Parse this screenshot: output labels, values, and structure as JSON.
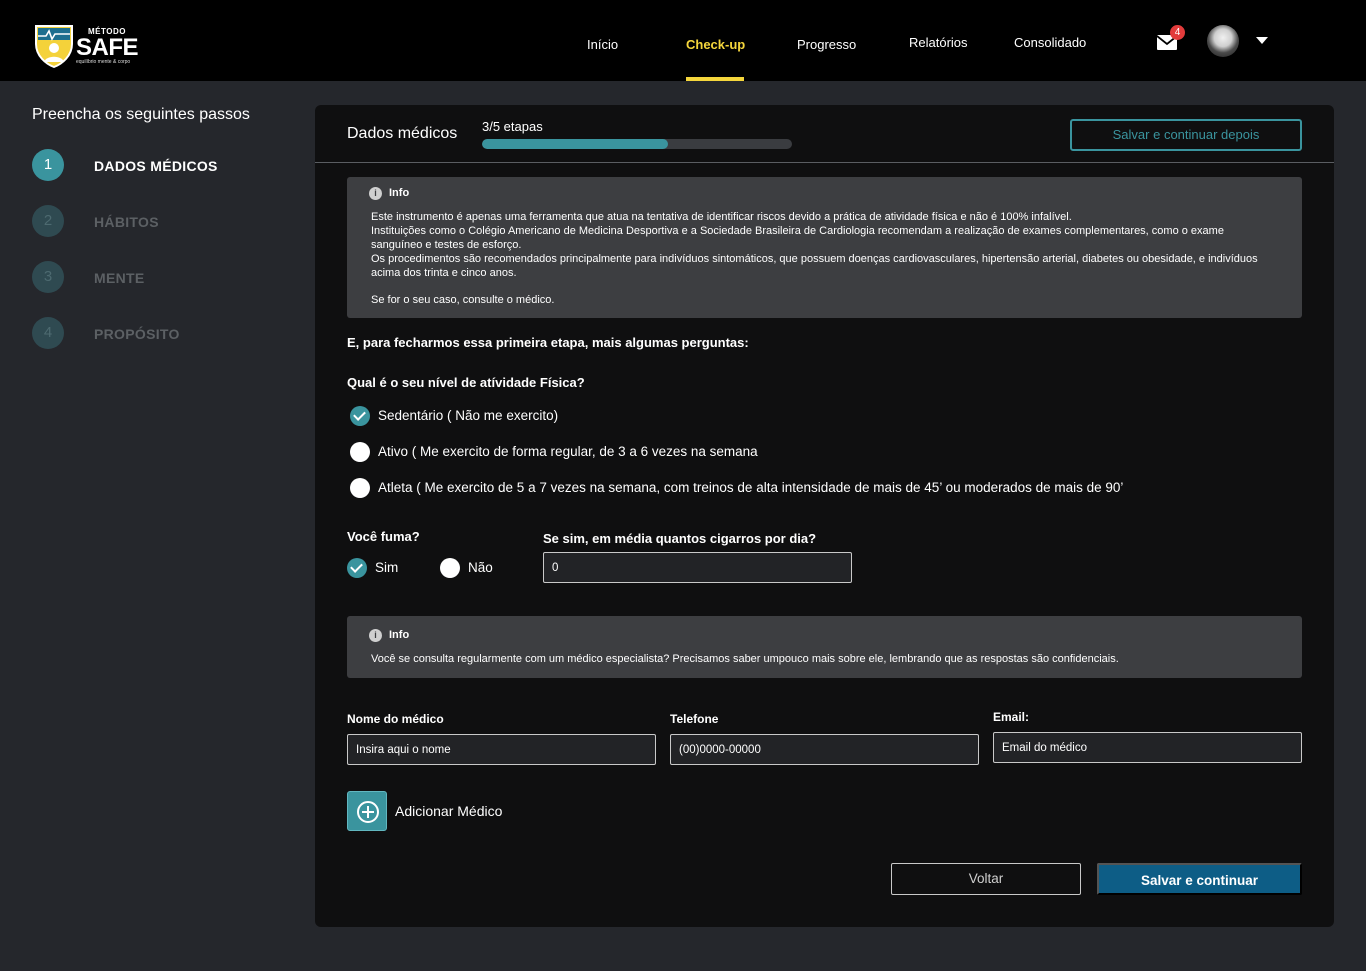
{
  "header": {
    "logo": {
      "top": "MÉTODO",
      "main": "SAFE",
      "sub": "equilíbrio mente & corpo"
    },
    "nav": [
      {
        "label": "Início"
      },
      {
        "label": "Check-up"
      },
      {
        "label": "Progresso"
      },
      {
        "label": "Relatórios"
      },
      {
        "label": "Consolidado"
      }
    ],
    "active_nav": "Check-up",
    "mail_badge": "4",
    "icons": [
      "mail-icon",
      "avatar",
      "chevron-down-icon"
    ]
  },
  "sidebar": {
    "title": "Preencha os seguintes passos",
    "steps": [
      {
        "number": "1",
        "label": "DADOS MÉDICOS",
        "active": true
      },
      {
        "number": "2",
        "label": "HÁBITOS",
        "active": false
      },
      {
        "number": "3",
        "label": "MENTE",
        "active": false
      },
      {
        "number": "4",
        "label": "PROPÓSITO",
        "active": false
      }
    ]
  },
  "card": {
    "title": "Dados médicos",
    "steps_text": "3/5 etapas",
    "progress_fraction": 0.6,
    "save_later_label": "Salvar e continuar depois",
    "info1": {
      "heading": "Info",
      "line1": "Este instrumento é apenas uma ferramenta que atua na tentativa de identificar riscos devido a prática de atividade física e não é 100% infalível.",
      "line2": "Instituições como o Colégio Americano de Medicina Desportiva e a Sociedade Brasileira de Cardiologia recomendam a realização de exames complementares, como o exame sanguíneo e testes de esforço.",
      "line3": "Os procedimentos são recomendados principalmente para indivíduos sintomáticos, que possuem doenças cardiovasculares, hipertensão arterial, diabetes ou obesidade, e indivíduos acima dos trinta e cinco anos.",
      "line4": "Se for o seu caso, consulte o médico."
    },
    "intro": "E, para fecharmos essa primeira etapa, mais algumas perguntas:",
    "activity_question": "Qual é o seu nível de atívidade Física?",
    "activity_options": [
      {
        "label": "Sedentário ( Não me exercito)",
        "checked": true
      },
      {
        "label": "Ativo ( Me exercito de forma regular, de 3 a 6 vezes na semana",
        "checked": false
      },
      {
        "label": "Atleta ( Me exercito de 5 a 7 vezes na semana, com treinos de alta intensidade de mais de 45’ ou moderados de mais de 90’",
        "checked": false
      }
    ],
    "smoke_question": "Você fuma?",
    "smoke_options": [
      {
        "label": "Sim",
        "checked": true
      },
      {
        "label": "Não",
        "checked": false
      }
    ],
    "cigarettes_question": "Se sim, em média quantos cigarros por dia?",
    "cigarettes_value": "0",
    "info2": {
      "heading": "Info",
      "text": "Você se consulta regularmente com um médico especialista? Precisamos saber umpouco mais sobre ele, lembrando que as respostas são confidenciais."
    },
    "doctor": {
      "name_label": "Nome do médico",
      "name_placeholder": "Insira aqui o nome",
      "phone_label": "Telefone",
      "phone_placeholder": "(00)0000-00000",
      "email_label": "Email:",
      "email_placeholder": "Email do médico"
    },
    "add_doctor_label": "Adicionar Médico",
    "back_label": "Voltar",
    "save_label": "Salvar  e continuar"
  },
  "colors": {
    "accent": "#3a949e",
    "nav_active": "#f5d63c",
    "primary_button": "#0d5d86",
    "badge": "#e23b3b"
  }
}
